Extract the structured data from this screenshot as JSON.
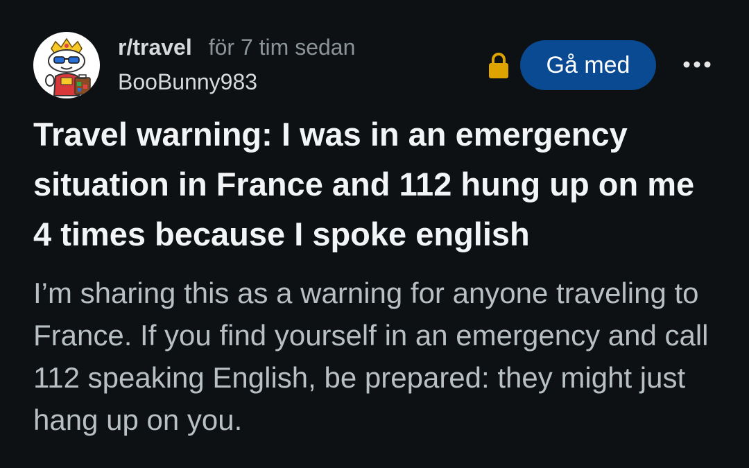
{
  "post": {
    "subreddit": "r/travel",
    "time": "för 7 tim sedan",
    "username": "BooBunny983",
    "join_label": "Gå med",
    "more_label": "•••",
    "title": "Travel warning: I was in an emergency situation in France and 112 hung up on me 4 times because I spoke english",
    "body": "I’m sharing this as a warning for anyone traveling to France. If you find yourself in an emergency and call 112 speaking English, be prepared: they might just hang up on you."
  },
  "colors": {
    "background": "#0e1113",
    "join_button": "#0a4a92",
    "lock": "#e0a400",
    "title": "#f2f4f5",
    "body": "#b8c0c4",
    "meta": "#8b9599"
  },
  "icons": {
    "avatar": "snoo-avatar-icon",
    "lock": "lock-icon",
    "more": "more-options-icon"
  }
}
